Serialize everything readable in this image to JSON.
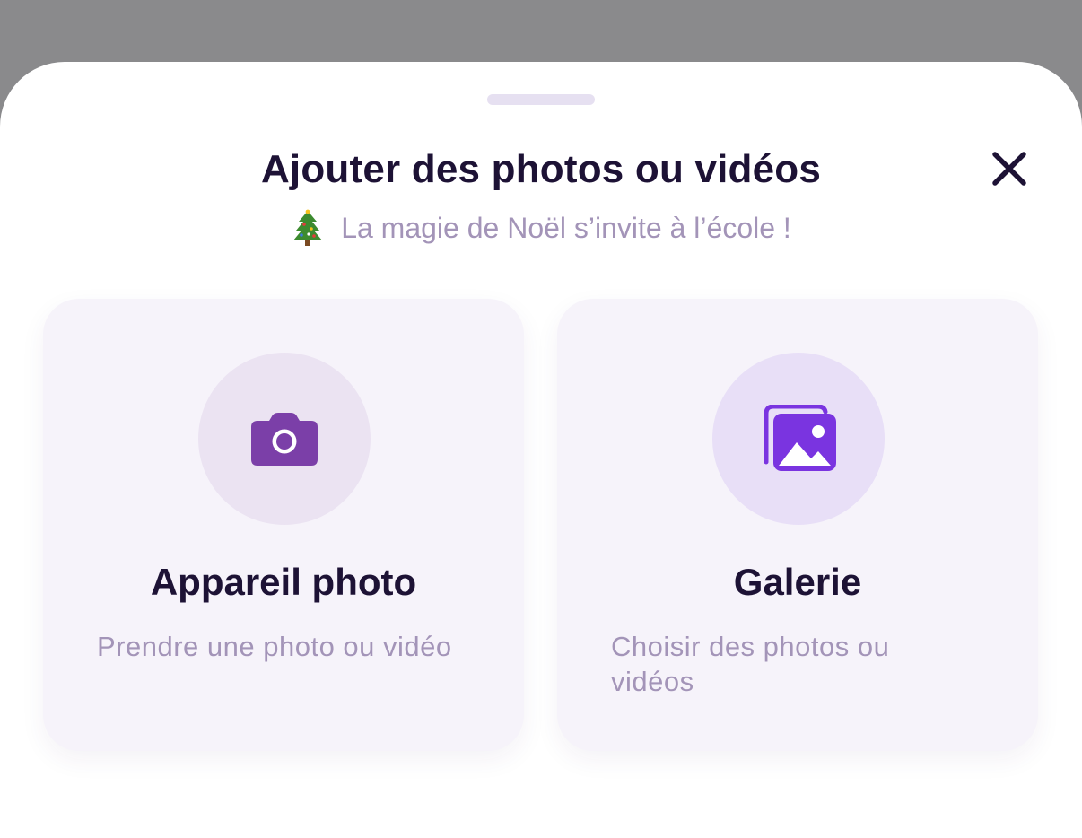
{
  "sheet": {
    "title": "Ajouter des photos ou vidéos",
    "subtitle_icon": "christmas-tree-icon",
    "subtitle": "La magie de Noël s’invite à l’école !",
    "close_icon": "close-icon"
  },
  "options": {
    "camera": {
      "icon": "camera-icon",
      "title": "Appareil photo",
      "description": "Prendre une photo ou vidéo"
    },
    "gallery": {
      "icon": "gallery-icon",
      "title": "Galerie",
      "description": "Choisir des photos ou vidéos"
    }
  },
  "colors": {
    "backdrop": "#8a8a8c",
    "title": "#1d1235",
    "muted_text": "#a394b8",
    "camera_accent": "#7b3fa8",
    "gallery_accent": "#7a34e0",
    "card_bg": "#f6f3fa"
  }
}
